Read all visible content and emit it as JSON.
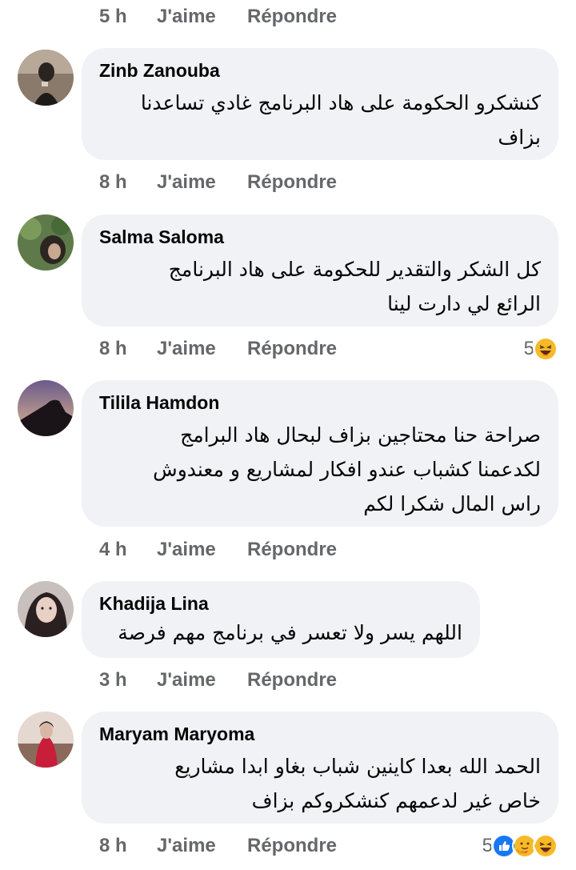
{
  "top_row": {
    "time": "5 h",
    "like": "J'aime",
    "reply": "Répondre"
  },
  "comments": [
    {
      "author": "Zinb Zanouba",
      "lines": [
        "كنشكرو الحكومة على هاد البرنامج غادي تساعدنا",
        "بزاف"
      ],
      "time": "8 h",
      "like": "J'aime",
      "reply": "Répondre",
      "reaction_count": ""
    },
    {
      "author": "Salma Saloma",
      "lines": [
        "كل الشكر والتقدير للحكومة على هاد البرنامج",
        "الرائع لي دارت لينا"
      ],
      "time": "8 h",
      "like": "J'aime",
      "reply": "Répondre",
      "reaction_count": "5",
      "reaction_icons": [
        "haha-icon"
      ]
    },
    {
      "author": "Tilila Hamdon",
      "lines": [
        "صراحة حنا محتاجين بزاف لبحال هاد البرامج",
        "لكدعمنا كشباب عندو افكار لمشاريع و معندوش",
        "راس المال شكرا لكم"
      ],
      "time": "4 h",
      "like": "J'aime",
      "reply": "Répondre",
      "reaction_count": ""
    },
    {
      "author": "Khadija Lina",
      "lines": [
        "اللهم يسر ولا تعسر في برنامج مهم فرصة"
      ],
      "time": "3 h",
      "like": "J'aime",
      "reply": "Répondre",
      "reaction_count": ""
    },
    {
      "author": "Maryam Maryoma",
      "lines": [
        "الحمد الله بعدا كاينين شباب بغاو ابدا مشاريع",
        "خاص غير لدعمهم كنشكروكم بزاف"
      ],
      "time": "8 h",
      "like": "J'aime",
      "reply": "Répondre",
      "reaction_count": "5",
      "reaction_icons": [
        "like-icon",
        "care-icon",
        "haha-icon"
      ]
    }
  ],
  "colors": {
    "bubble": "#f0f2f5",
    "meta_text": "#65676b",
    "like_blue": "#1877f2",
    "haha_yellow": "#f7b928"
  }
}
